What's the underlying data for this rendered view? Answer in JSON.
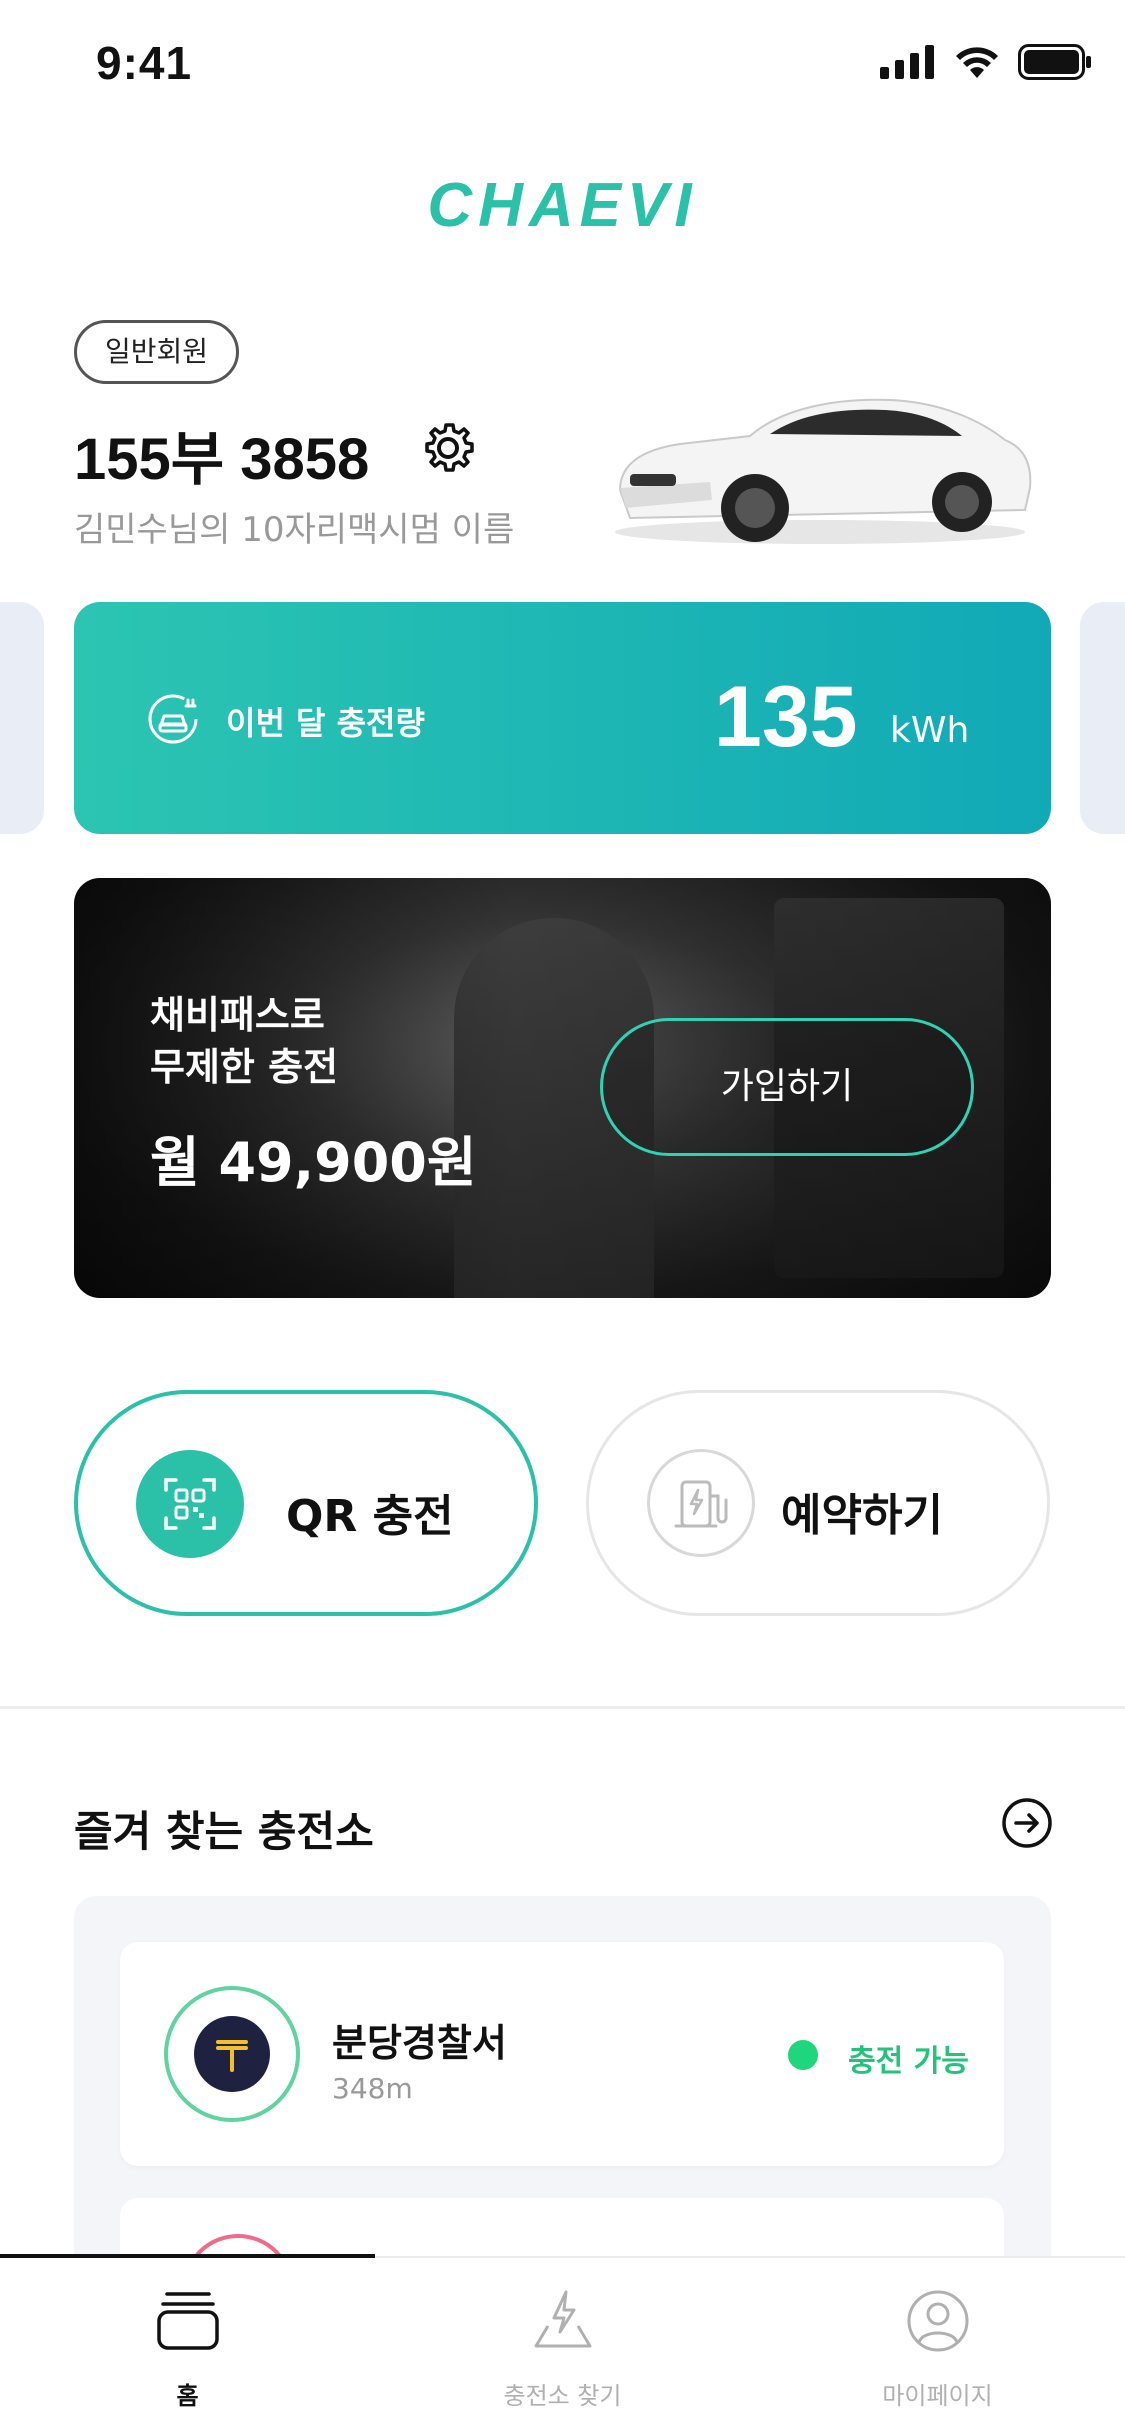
{
  "status_bar": {
    "time": "9:41"
  },
  "brand": {
    "logo_text": "CHAEVI",
    "accent": "#2bc0a8"
  },
  "member": {
    "badge": "일반회원",
    "plate": "155부 3858",
    "name_line": "김민수님의 10자리맥시멈 이름"
  },
  "charge_card": {
    "label": "이번 달 충전량",
    "value": "135",
    "unit": "kWh"
  },
  "promo": {
    "line1": "채비패스로",
    "line2": "무제한 충전",
    "price": "월 49,900원",
    "button": "가입하기"
  },
  "actions": {
    "qr_label": "QR 충전",
    "reserve_label": "예약하기"
  },
  "favorites": {
    "title": "즐겨 찾는 충전소",
    "items": [
      {
        "name": "분당경찰서",
        "distance": "348m",
        "status": "충전 가능",
        "status_color": "#22c37a"
      }
    ]
  },
  "tabbar": {
    "items": [
      {
        "label": "홈",
        "icon": "home-icon",
        "active": true
      },
      {
        "label": "충전소 찾기",
        "icon": "charger-map-icon",
        "active": false
      },
      {
        "label": "마이페이지",
        "icon": "profile-icon",
        "active": false
      }
    ]
  }
}
